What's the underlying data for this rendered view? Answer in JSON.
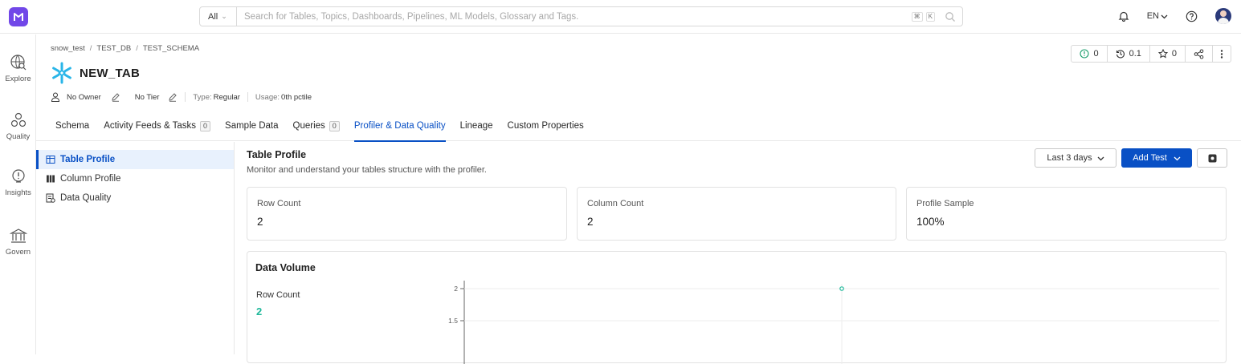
{
  "search": {
    "filter": "All",
    "placeholder": "Search for Tables, Topics, Dashboards, Pipelines, ML Models, Glossary and Tags.",
    "kbd1": "⌘",
    "kbd2": "K"
  },
  "header": {
    "language": "EN"
  },
  "leftnav": {
    "items": [
      {
        "label": "Explore",
        "icon": "explore-icon"
      },
      {
        "label": "Quality",
        "icon": "quality-icon"
      },
      {
        "label": "Insights",
        "icon": "insights-icon"
      },
      {
        "label": "Govern",
        "icon": "govern-icon"
      }
    ]
  },
  "breadcrumb": [
    "snow_test",
    "TEST_DB",
    "TEST_SCHEMA"
  ],
  "entity": {
    "name": "NEW_TAB",
    "owner": "No Owner",
    "tier": "No Tier",
    "type_label": "Type:",
    "type_value": "Regular",
    "usage_label": "Usage:",
    "usage_value": "0th pctile"
  },
  "actions": {
    "tasks": "0",
    "version": "0.1",
    "stars": "0"
  },
  "tabs": [
    {
      "label": "Schema",
      "count": null
    },
    {
      "label": "Activity Feeds & Tasks",
      "count": "0"
    },
    {
      "label": "Sample Data",
      "count": null
    },
    {
      "label": "Queries",
      "count": "0"
    },
    {
      "label": "Profiler & Data Quality",
      "count": null,
      "active": true
    },
    {
      "label": "Lineage",
      "count": null
    },
    {
      "label": "Custom Properties",
      "count": null
    }
  ],
  "sidebar": {
    "items": [
      {
        "label": "Table Profile",
        "active": true
      },
      {
        "label": "Column Profile"
      },
      {
        "label": "Data Quality"
      }
    ]
  },
  "profile": {
    "title": "Table Profile",
    "subtitle": "Monitor and understand your tables structure with the profiler.",
    "range_label": "Last 3 days",
    "add_test_label": "Add Test",
    "cards": [
      {
        "label": "Row Count",
        "value": "2"
      },
      {
        "label": "Column Count",
        "value": "2"
      },
      {
        "label": "Profile Sample",
        "value": "100%"
      }
    ]
  },
  "volume": {
    "title": "Data Volume",
    "row_count_label": "Row Count",
    "row_count_value": "2"
  },
  "chart_data": {
    "type": "line",
    "y_ticks": [
      "2",
      "1.5"
    ],
    "series": [
      {
        "values": [
          2
        ]
      }
    ],
    "color": "#1fb89a"
  }
}
